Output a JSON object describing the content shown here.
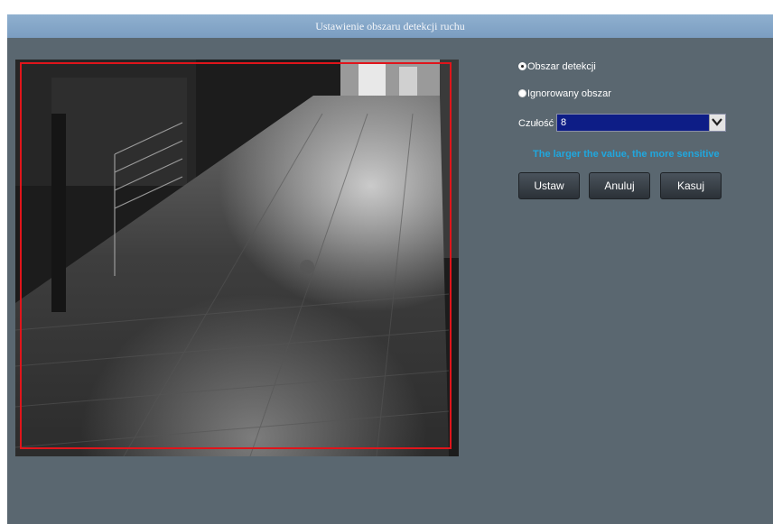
{
  "window": {
    "title": "Ustawienie obszaru detekcji ruchu"
  },
  "options": {
    "detection_area": "Obszar detekcji",
    "ignored_area": "Ignorowany obszar",
    "selected": "detection_area"
  },
  "sensitivity": {
    "label": "Czułość",
    "value": "8"
  },
  "hint": "The larger the value, the more sensitive",
  "buttons": {
    "set": "Ustaw",
    "cancel": "Anuluj",
    "clear": "Kasuj"
  },
  "colors": {
    "window_bg": "#5a6770",
    "titlebar": "#7b9dc1",
    "detection_border": "#e0151b",
    "select_bg": "#0d1d86",
    "hint": "#20a7de"
  }
}
